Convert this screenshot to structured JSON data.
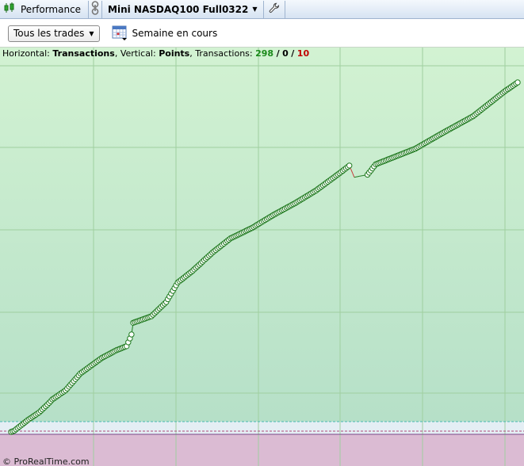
{
  "toolbar": {
    "performance_label": "Performance",
    "instrument_label": "Mini NASDAQ100 Full0322",
    "icons": [
      "candlestick-icon",
      "link-icon",
      "chevron-down-icon",
      "wrench-icon"
    ]
  },
  "filters": {
    "trades_dropdown_value": "Tous les trades",
    "period_label": "Semaine en cours",
    "icons": [
      "calendar-icon"
    ]
  },
  "chart_info": {
    "horizontal_prefix": "Horizontal:",
    "horizontal_value": "Transactions",
    "vertical_prefix": "Vertical:",
    "vertical_value": "Points",
    "transactions_prefix": "Transactions:",
    "transactions_winning": "298",
    "transactions_neutral": "0",
    "transactions_losing": "10",
    "sep": "/"
  },
  "footer": {
    "copyright": "© ProRealTime.com"
  },
  "colors": {
    "curve": "#1f7a1f",
    "curve_loss": "#c83a3a",
    "marker_fill": "#ffffff",
    "marker_stroke": "#1f7a1f",
    "positive_zone_top": "#d2f2d2",
    "positive_zone_bottom": "#b6e0c8",
    "negative_zone": "#dbbbd3",
    "zero_line": "#7b4a8a",
    "grid": "#9fcf9f"
  },
  "chart_data": {
    "type": "line",
    "xlabel": "Transactions",
    "ylabel": "Points",
    "n_trades": 308,
    "markers": "on every winning trade",
    "grid": true,
    "legend": "none",
    "series": [
      {
        "anchors": [
          [
            0,
            0
          ],
          [
            2,
            1
          ],
          [
            10,
            9
          ],
          [
            17,
            15
          ],
          [
            22,
            21
          ],
          [
            25,
            25
          ],
          [
            33,
            32
          ],
          [
            42,
            45
          ],
          [
            55,
            57
          ],
          [
            64,
            63
          ],
          [
            70,
            66
          ],
          [
            73,
            75
          ],
          [
            74,
            84
          ],
          [
            85,
            89
          ],
          [
            94,
            100
          ],
          [
            101,
            115
          ],
          [
            110,
            124
          ],
          [
            122,
            138
          ],
          [
            133,
            149
          ],
          [
            146,
            157
          ],
          [
            159,
            167
          ],
          [
            172,
            176
          ],
          [
            185,
            186
          ],
          [
            201,
            201
          ],
          [
            205,
            205
          ],
          [
            208,
            196
          ],
          [
            212,
            197
          ],
          [
            216,
            198
          ],
          [
            221,
            206
          ],
          [
            225,
            208
          ],
          [
            235,
            213
          ],
          [
            245,
            218
          ],
          [
            260,
            229
          ],
          [
            270,
            236
          ],
          [
            280,
            243
          ],
          [
            290,
            253
          ],
          [
            299,
            262
          ],
          [
            307,
            269
          ]
        ]
      }
    ]
  }
}
